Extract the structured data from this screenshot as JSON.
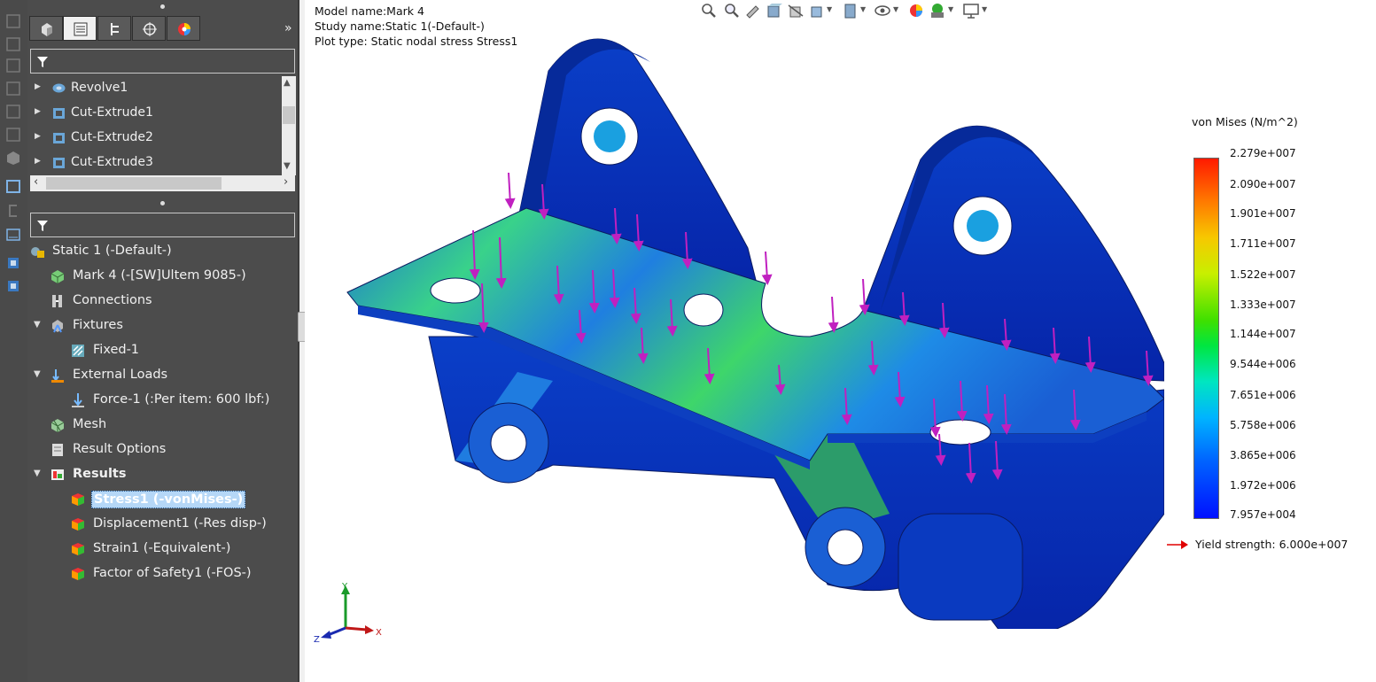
{
  "feature_tree": {
    "items": [
      {
        "label": "Revolve1"
      },
      {
        "label": "Cut-Extrude1"
      },
      {
        "label": "Cut-Extrude2"
      },
      {
        "label": "Cut-Extrude3"
      }
    ]
  },
  "simulation_tree": {
    "study": "Static 1 (-Default-)",
    "part": "Mark 4 (-[SW]Ultem 9085-)",
    "connections": "Connections",
    "fixtures": "Fixtures",
    "fixed": "Fixed-1",
    "external_loads": "External Loads",
    "force": "Force-1 (:Per item: 600 lbf:)",
    "mesh": "Mesh",
    "result_options": "Result Options",
    "results": "Results",
    "result_items": [
      {
        "label": "Stress1 (-vonMises-)"
      },
      {
        "label": "Displacement1 (-Res disp-)"
      },
      {
        "label": "Strain1 (-Equivalent-)"
      },
      {
        "label": "Factor of Safety1 (-FOS-)"
      }
    ]
  },
  "model_info": {
    "model_name": "Model name:Mark 4",
    "study_name": "Study name:Static 1(-Default-)",
    "plot_type": "Plot type: Static nodal stress Stress1"
  },
  "legend": {
    "title": "von Mises (N/m^2)",
    "values": [
      "2.279e+007",
      "2.090e+007",
      "1.901e+007",
      "1.711e+007",
      "1.522e+007",
      "1.333e+007",
      "1.144e+007",
      "9.544e+006",
      "7.651e+006",
      "5.758e+006",
      "3.865e+006",
      "1.972e+006",
      "7.957e+004"
    ],
    "yield": "Yield strength: 6.000e+007",
    "colors": {
      "max": "#ff1a00",
      "min": "#0010ff",
      "yield_arrow": "#e00000"
    }
  },
  "triad": {
    "x": "X",
    "y": "Y",
    "z": "Z"
  },
  "icons": {
    "tabs": [
      "part-icon",
      "feature-manager-icon",
      "property-manager-icon",
      "configuration-manager-icon",
      "appearance-icon"
    ],
    "view_toolbar": [
      "zoom-to-fit-icon",
      "zoom-to-area-icon",
      "previous-view-icon",
      "section-view-icon",
      "view-orientation-icon",
      "display-style-icon",
      "hide-show-icon",
      "edit-appearance-icon",
      "apply-scene-icon",
      "view-settings-icon"
    ]
  }
}
